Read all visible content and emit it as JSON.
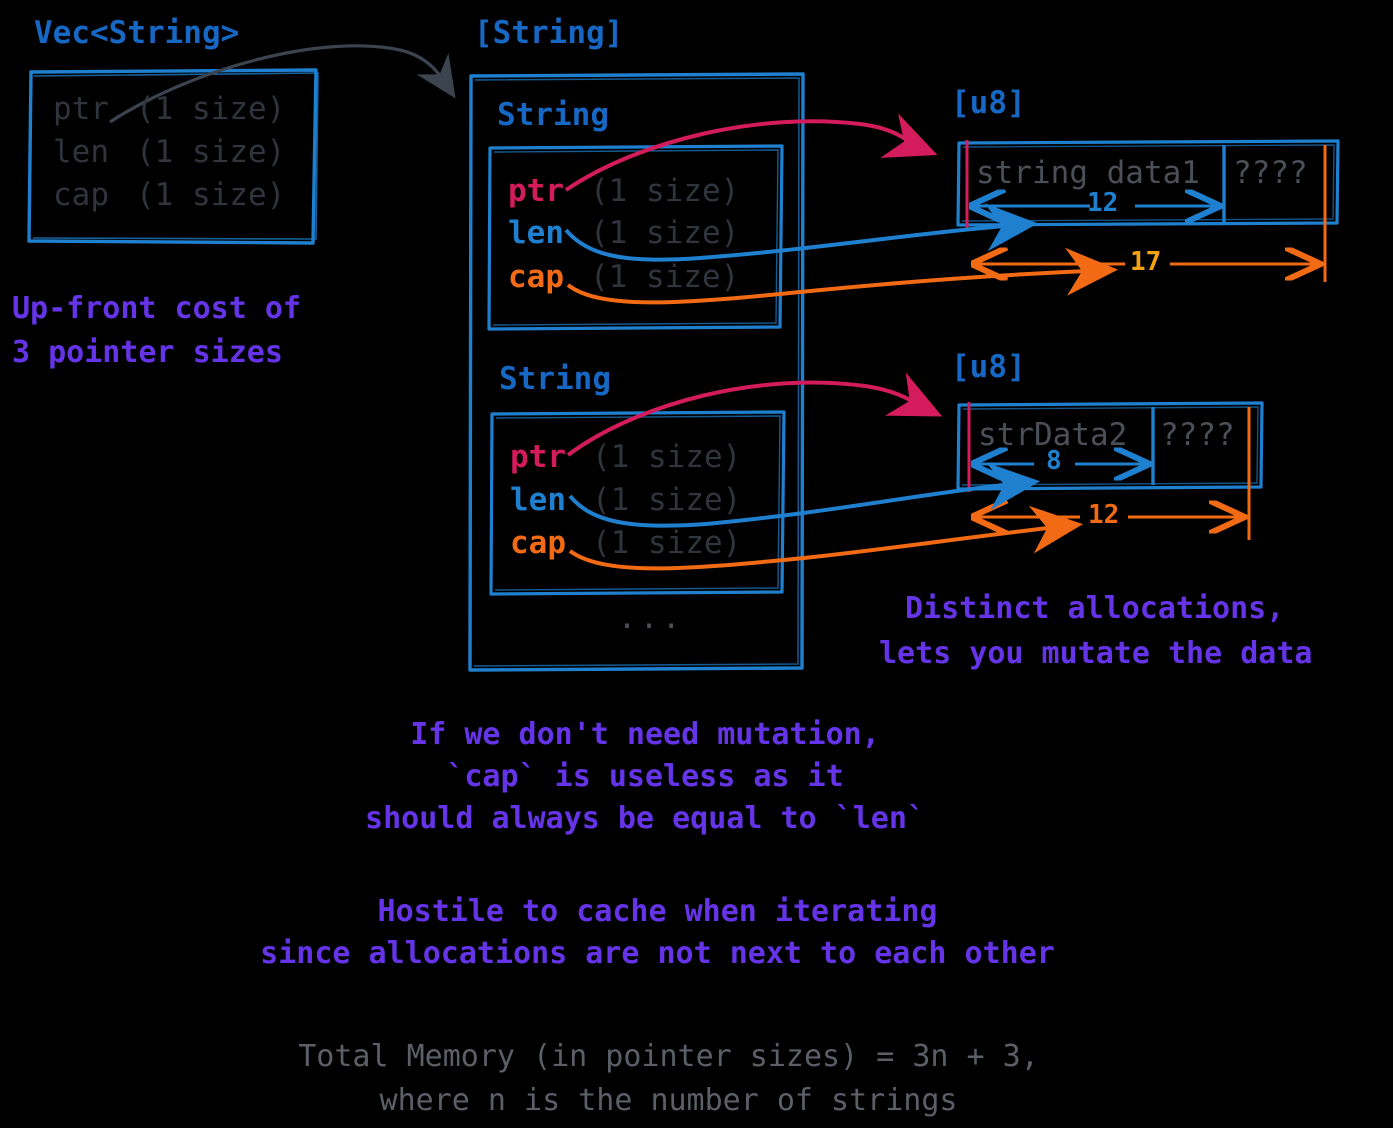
{
  "diagram": {
    "title_vec": "Vec<String>",
    "title_string_slice": "[String]",
    "title_u8_1": "[u8]",
    "title_u8_2": "[u8]",
    "string_label_1": "String",
    "string_label_2": "String",
    "ellipsis": "..."
  },
  "vec_fields": [
    {
      "name": "ptr",
      "size": "(1 size)"
    },
    {
      "name": "len",
      "size": "(1 size)"
    },
    {
      "name": "cap",
      "size": "(1 size)"
    }
  ],
  "string_1_fields": [
    {
      "name": "ptr",
      "size": "(1 size)"
    },
    {
      "name": "len",
      "size": "(1 size)"
    },
    {
      "name": "cap",
      "size": "(1 size)"
    }
  ],
  "string_2_fields": [
    {
      "name": "ptr",
      "size": "(1 size)"
    },
    {
      "name": "len",
      "size": "(1 size)"
    },
    {
      "name": "cap",
      "size": "(1 size)"
    }
  ],
  "buffers": [
    {
      "id": "buffer-1",
      "type": "[u8]",
      "data_text": "string data1",
      "slack_text": "????",
      "len_label": "12",
      "cap_label": "17"
    },
    {
      "id": "buffer-2",
      "type": "[u8]",
      "data_text": "strData2",
      "slack_text": "????",
      "len_label": "8",
      "cap_label": "12"
    }
  ],
  "annotations": {
    "upfront_cost": [
      "Up-front cost of",
      "3 pointer sizes"
    ],
    "distinct_allocations": [
      "Distinct allocations,",
      "lets you mutate the data"
    ],
    "no_mutation": [
      "If we don't need mutation,",
      "`cap` is useless as it",
      "should always be equal to `len`"
    ],
    "cache_hostile": [
      "Hostile to cache when iterating",
      "since allocations are not next to each other"
    ],
    "total_memory": [
      "Total Memory (in pointer sizes) = 3n + 3,",
      "where n is the number of strings"
    ]
  },
  "colors": {
    "heading_blue": "#1668c4",
    "ptr_pink": "#d41c5c",
    "len_blue": "#1f80d0",
    "cap_orange": "#f26a14",
    "annotation_purple": "#6634e8",
    "body_gray": "#2f343d",
    "footer_gray": "#5a5f68",
    "amber": "#f5a313",
    "background": "#000000"
  }
}
